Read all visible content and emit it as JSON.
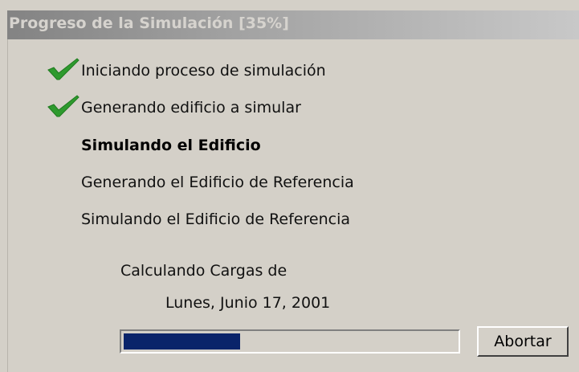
{
  "window": {
    "title_main": "Progreso de la Simulación ",
    "title_pct": "[35%]"
  },
  "steps": [
    {
      "label": "Iniciando proceso de simulación",
      "status": "done",
      "icon": "check-icon"
    },
    {
      "label": "Generando edificio a simular",
      "status": "done",
      "icon": "check-icon"
    },
    {
      "label": "Simulando el Edificio",
      "status": "active"
    },
    {
      "label": "Generando el Edificio de Referencia",
      "status": "pending"
    },
    {
      "label": "Simulando el Edificio de Referencia",
      "status": "pending"
    }
  ],
  "calculation": {
    "line1": "Calculando Cargas de",
    "line2": "Lunes, Junio 17, 2001"
  },
  "progress": {
    "value_fraction": 0.35,
    "fill_color": "#0a246a"
  },
  "buttons": {
    "abort_label": "Abortar"
  },
  "colors": {
    "check": "#2e9a2e",
    "window_bg": "#d4d0c8"
  }
}
